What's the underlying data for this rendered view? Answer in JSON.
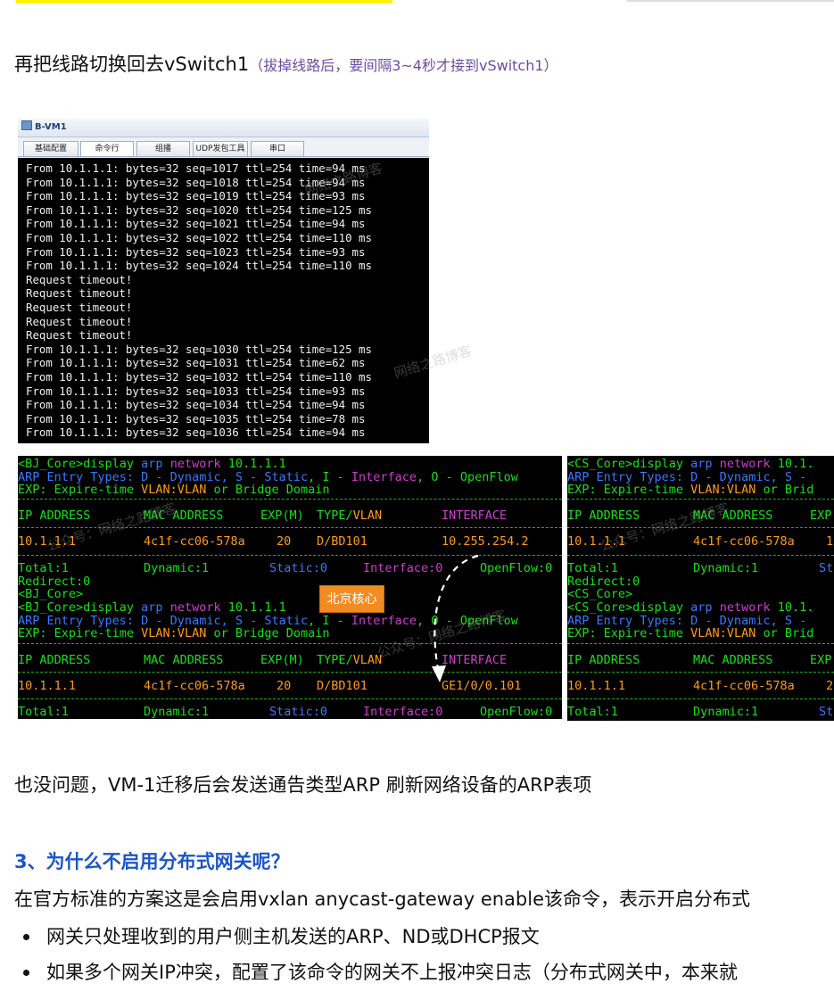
{
  "intro": {
    "text": "再把线路切换回去vSwitch1",
    "note": "（拔掉线路后，要间隔3~4秒才接到vSwitch1）"
  },
  "vm": {
    "title": "B-VM1",
    "tabs": [
      "基础配置",
      "命令行",
      "组播",
      "UDP发包工具",
      "串口"
    ],
    "active_tab": "命令行",
    "lines": [
      "From 10.1.1.1: bytes=32 seq=1017 ttl=254 time=94 ms",
      "From 10.1.1.1: bytes=32 seq=1018 ttl=254 time=94 ms",
      "From 10.1.1.1: bytes=32 seq=1019 ttl=254 time=93 ms",
      "From 10.1.1.1: bytes=32 seq=1020 ttl=254 time=125 ms",
      "From 10.1.1.1: bytes=32 seq=1021 ttl=254 time=94 ms",
      "From 10.1.1.1: bytes=32 seq=1022 ttl=254 time=110 ms",
      "From 10.1.1.1: bytes=32 seq=1023 ttl=254 time=93 ms",
      "From 10.1.1.1: bytes=32 seq=1024 ttl=254 time=110 ms",
      "Request timeout!",
      "Request timeout!",
      "Request timeout!",
      "Request timeout!",
      "Request timeout!",
      "From 10.1.1.1: bytes=32 seq=1030 ttl=254 time=125 ms",
      "From 10.1.1.1: bytes=32 seq=1031 ttl=254 time=62 ms",
      "From 10.1.1.1: bytes=32 seq=1032 ttl=254 time=110 ms",
      "From 10.1.1.1: bytes=32 seq=1033 ttl=254 time=93 ms",
      "From 10.1.1.1: bytes=32 seq=1034 ttl=254 time=94 ms",
      "From 10.1.1.1: bytes=32 seq=1035 ttl=254 time=78 ms",
      "From 10.1.1.1: bytes=32 seq=1036 ttl=254 time=94 ms"
    ]
  },
  "bj_terminal": {
    "prompt1": "<BJ_Core>display ",
    "cmd_arp": "arp",
    "cmd_network": "network",
    "cmd_ip": "10.1.1.1",
    "arp_types_prefix": "ARP Entry Types: D - Dynamic, S - ",
    "arp_static": "Static",
    "arp_mid": ", I - ",
    "arp_interface": "Interface",
    "arp_suffix": ", O - OpenFlow",
    "exp_prefix": "EXP: Expire-time ",
    "exp_vlan": "VLAN:VLAN",
    "exp_suffix": " or Bridge Domain",
    "hdr_ip": "IP ADDRESS",
    "hdr_mac": "MAC ADDRESS",
    "hdr_exp": "EXP(M)",
    "hdr_type": "TYPE/",
    "hdr_vlan": "VLAN",
    "hdr_iface": "INTERFACE",
    "row1_ip": "10.1.1.1",
    "row1_mac": "4c1f-cc06-578a",
    "row1_exp": "20",
    "row1_type": "D/BD101",
    "row1_iface": "10.255.254.2",
    "total": "Total:1",
    "dynamic": "Dynamic:1",
    "static_count": "Static:0",
    "interface_count": "Interface:0",
    "openflow_count": "OpenFlow:0",
    "redirect": "Redirect:0",
    "prompt_bare": "<BJ_Core>",
    "row2_ip": "10.1.1.1",
    "row2_mac": "4c1f-cc06-578a",
    "row2_exp": "20",
    "row2_type": "D/BD101",
    "row2_iface": "GE1/0/0.101",
    "badge": "北京核心"
  },
  "cs_terminal": {
    "prompt1": "<CS_Core>display ",
    "cmd_arp": "arp",
    "cmd_network": "network",
    "cmd_ip": "10.1.",
    "arp_types_prefix": "ARP Entry Types: D - Dynamic, S - ",
    "exp_prefix": "EXP: Expire-time ",
    "exp_vlan": "VLAN:VLAN",
    "exp_suffix": " or Brid",
    "hdr_ip": "IP ADDRESS",
    "hdr_mac": "MAC ADDRESS",
    "hdr_exp": "EXP",
    "row1_ip": "10.1.1.1",
    "row1_mac": "4c1f-cc06-578a",
    "row1_exp": "1",
    "total": "Total:1",
    "dynamic": "Dynamic:1",
    "static_trunc": "St",
    "redirect": "Redirect:0",
    "prompt_bare": "<CS_Core>",
    "row2_ip": "10.1.1.1",
    "row2_mac": "4c1f-cc06-578a",
    "row2_exp": "2"
  },
  "watermark": {
    "text1": "公众号：网络之路博客",
    "text2": "网络之路博客"
  },
  "after_text": "也没问题，VM-1迁移后会发送通告类型ARP 刷新网络设备的ARP表项",
  "section": {
    "heading": "3、为什么不启用分布式网关呢？",
    "paragraph": "在官方标准的方案这是会启用vxlan anycast-gateway enable该命令，表示开启分布式",
    "bullets": [
      "网关只处理收到的用户侧主机发送的ARP、ND或DHCP报文",
      "如果多个网关IP冲突，配置了该命令的网关不上报冲突日志（分布式网关中，本来就"
    ]
  },
  "colors": {
    "green": "#18e018",
    "blue": "#3a78ff",
    "magenta": "#d13cd1",
    "orange": "#ff9a1f",
    "heading": "#1a56c8",
    "note": "#6a4ca5",
    "badge": "#f08c21"
  }
}
